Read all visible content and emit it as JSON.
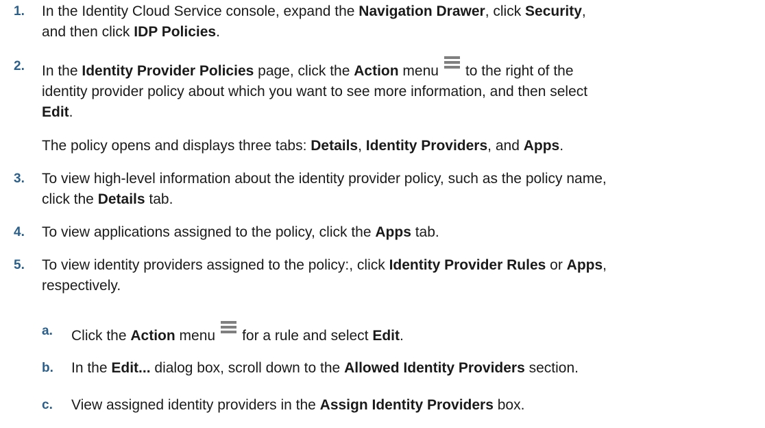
{
  "steps": [
    {
      "number": "1.",
      "segments": [
        {
          "t": "In the Identity Cloud Service console, expand the "
        },
        {
          "b": "Navigation Drawer"
        },
        {
          "t": ", click "
        },
        {
          "b": "Security"
        },
        {
          "t": ","
        },
        {
          "br": true
        },
        {
          "t": "and then click "
        },
        {
          "b": "IDP Policies"
        },
        {
          "t": "."
        }
      ]
    },
    {
      "number": "2.",
      "segments": [
        {
          "t": "In the "
        },
        {
          "b": "Identity Provider Policies"
        },
        {
          "t": " page, click the "
        },
        {
          "b": "Action"
        },
        {
          "t": " menu"
        },
        {
          "icon": "action-menu-icon"
        },
        {
          "t": "to the right of the"
        },
        {
          "br": true
        },
        {
          "t": "identity provider policy about which you want to see more information, and then select"
        },
        {
          "br": true
        },
        {
          "b": "Edit"
        },
        {
          "t": "."
        }
      ],
      "note": [
        {
          "t": "The policy opens and displays three tabs: "
        },
        {
          "b": "Details"
        },
        {
          "t": ", "
        },
        {
          "b": "Identity Providers"
        },
        {
          "t": ", and "
        },
        {
          "b": "Apps"
        },
        {
          "t": "."
        }
      ]
    },
    {
      "number": "3.",
      "segments": [
        {
          "t": "To view high-level information about the identity provider policy, such as the policy name,"
        },
        {
          "br": true
        },
        {
          "t": "click the "
        },
        {
          "b": "Details"
        },
        {
          "t": " tab."
        }
      ]
    },
    {
      "number": "4.",
      "segments": [
        {
          "t": "To view applications assigned to the policy, click the "
        },
        {
          "b": "Apps"
        },
        {
          "t": " tab."
        }
      ]
    },
    {
      "number": "5.",
      "segments": [
        {
          "t": "To view identity providers assigned to the policy:, click "
        },
        {
          "b": "Identity Provider Rules"
        },
        {
          "t": " or "
        },
        {
          "b": "Apps"
        },
        {
          "t": ","
        },
        {
          "br": true
        },
        {
          "t": "respectively."
        }
      ],
      "substeps": [
        {
          "number": "a.",
          "segments": [
            {
              "t": "Click the "
            },
            {
              "b": "Action"
            },
            {
              "t": " menu"
            },
            {
              "icon": "action-menu-icon"
            },
            {
              "t": "for a rule and select "
            },
            {
              "b": "Edit"
            },
            {
              "t": "."
            }
          ]
        },
        {
          "number": "b.",
          "segments": [
            {
              "t": "In the "
            },
            {
              "b": "Edit..."
            },
            {
              "t": " dialog box, scroll down to the "
            },
            {
              "b": "Allowed Identity Providers"
            },
            {
              "t": " section."
            }
          ]
        },
        {
          "number": "c.",
          "segments": [
            {
              "t": "View assigned identity providers in the "
            },
            {
              "b": "Assign Identity Providers"
            },
            {
              "t": " box."
            }
          ]
        }
      ]
    }
  ],
  "colors": {
    "step_number": "#2b5f8a",
    "body_text": "#1a1a1a",
    "icon": "#7f7f7f"
  }
}
